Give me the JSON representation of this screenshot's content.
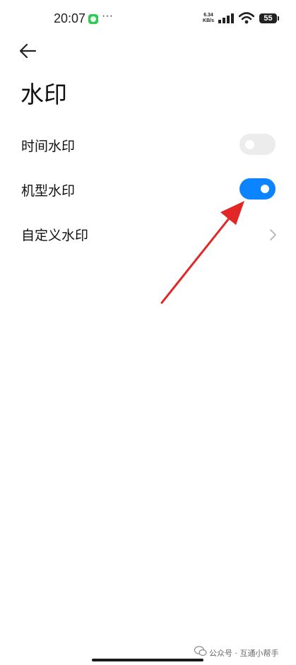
{
  "status_bar": {
    "time": "20:07",
    "more": "···",
    "net_speed_value": "6.34",
    "net_speed_unit": "KB/s",
    "battery": "55"
  },
  "header": {
    "back_icon": "arrow-left-icon",
    "title": "水印"
  },
  "settings": [
    {
      "label": "时间水印",
      "control": "toggle",
      "enabled": false
    },
    {
      "label": "机型水印",
      "control": "toggle",
      "enabled": true
    },
    {
      "label": "自定义水印",
      "control": "chevron"
    }
  ],
  "colors": {
    "toggle_on": "#0d84ff",
    "toggle_off": "#ececec",
    "annotation_arrow": "#e32626"
  },
  "footer": {
    "watermark": "公众号 · 互通小帮手"
  }
}
